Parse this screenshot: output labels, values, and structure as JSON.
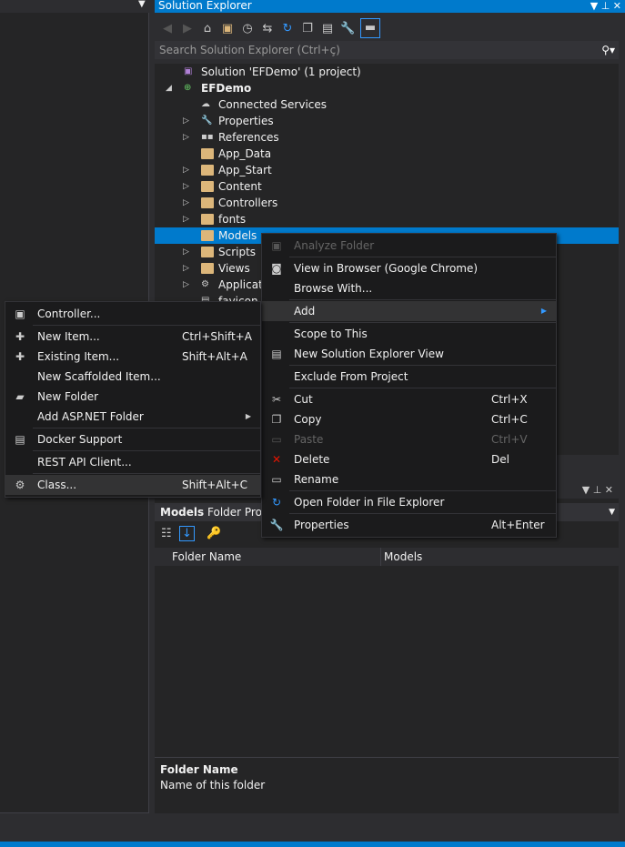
{
  "left_panel": {
    "dropdown_icon": "chevron-down-icon"
  },
  "solution_explorer": {
    "title": "Solution Explorer",
    "search_placeholder": "Search Solution Explorer (Ctrl+ç)",
    "tree": [
      {
        "label": "Solution 'EFDemo' (1 project)",
        "level": 0,
        "expander": "",
        "icon": "solution"
      },
      {
        "label": "EFDemo",
        "level": 0,
        "expander": "expanded",
        "icon": "web-project",
        "bold": true
      },
      {
        "label": "Connected Services",
        "level": 1,
        "expander": "",
        "icon": "cloud"
      },
      {
        "label": "Properties",
        "level": 1,
        "expander": "collapsed",
        "icon": "wrench"
      },
      {
        "label": "References",
        "level": 1,
        "expander": "collapsed",
        "icon": "references"
      },
      {
        "label": "App_Data",
        "level": 1,
        "expander": "",
        "icon": "folder"
      },
      {
        "label": "App_Start",
        "level": 1,
        "expander": "collapsed",
        "icon": "folder"
      },
      {
        "label": "Content",
        "level": 1,
        "expander": "collapsed",
        "icon": "folder"
      },
      {
        "label": "Controllers",
        "level": 1,
        "expander": "collapsed",
        "icon": "folder"
      },
      {
        "label": "fonts",
        "level": 1,
        "expander": "collapsed",
        "icon": "folder"
      },
      {
        "label": "Models",
        "level": 1,
        "expander": "",
        "icon": "folder",
        "selected": true
      },
      {
        "label": "Scripts",
        "level": 1,
        "expander": "collapsed",
        "icon": "folder"
      },
      {
        "label": "Views",
        "level": 1,
        "expander": "collapsed",
        "icon": "folder"
      },
      {
        "label": "Applicati",
        "level": 1,
        "expander": "collapsed",
        "icon": "config"
      },
      {
        "label": "favicon.i",
        "level": 1,
        "expander": "",
        "icon": "file"
      }
    ]
  },
  "properties": {
    "object_name": "Models",
    "object_type": "Folder Prope",
    "grid": [
      {
        "name": "Folder Name",
        "value": "Models"
      }
    ],
    "description_title": "Folder Name",
    "description_text": "Name of this folder"
  },
  "context_menu": [
    {
      "label": "Analyze Folder",
      "disabled": true,
      "icon": "analyze-icon"
    },
    {
      "sep": true
    },
    {
      "label": "View in Browser (Google Chrome)",
      "icon": "browser-icon"
    },
    {
      "label": "Browse With..."
    },
    {
      "sep": true
    },
    {
      "label": "Add",
      "submenu": true,
      "highlighted": true
    },
    {
      "sep": true
    },
    {
      "label": "Scope to This"
    },
    {
      "label": "New Solution Explorer View",
      "icon": "new-view-icon"
    },
    {
      "sep": true
    },
    {
      "label": "Exclude From Project"
    },
    {
      "sep": true
    },
    {
      "label": "Cut",
      "shortcut": "Ctrl+X",
      "icon": "scissors-icon"
    },
    {
      "label": "Copy",
      "shortcut": "Ctrl+C",
      "icon": "copy-icon"
    },
    {
      "label": "Paste",
      "shortcut": "Ctrl+V",
      "disabled": true,
      "icon": "paste-icon"
    },
    {
      "label": "Delete",
      "shortcut": "Del",
      "icon": "delete-icon"
    },
    {
      "label": "Rename",
      "icon": "rename-icon"
    },
    {
      "sep": true
    },
    {
      "label": "Open Folder in File Explorer",
      "icon": "open-folder-icon"
    },
    {
      "sep": true
    },
    {
      "label": "Properties",
      "shortcut": "Alt+Enter",
      "icon": "wrench-icon"
    }
  ],
  "add_submenu": [
    {
      "label": "Controller...",
      "icon": "controller-icon"
    },
    {
      "sep": true
    },
    {
      "label": "New Item...",
      "shortcut": "Ctrl+Shift+A",
      "icon": "new-item-icon"
    },
    {
      "label": "Existing Item...",
      "shortcut": "Shift+Alt+A",
      "icon": "existing-item-icon"
    },
    {
      "label": "New Scaffolded Item..."
    },
    {
      "label": "New Folder",
      "icon": "new-folder-icon"
    },
    {
      "label": "Add ASP.NET Folder",
      "submenu": true
    },
    {
      "sep": true
    },
    {
      "label": "Docker Support",
      "icon": "docker-icon"
    },
    {
      "sep": true
    },
    {
      "label": "REST API Client..."
    },
    {
      "sep": true
    },
    {
      "label": "Class...",
      "shortcut": "Shift+Alt+C",
      "highlighted": true,
      "icon": "class-icon"
    }
  ],
  "colors": {
    "accent": "#007acc",
    "background": "#252526",
    "menu": "#1b1b1c"
  }
}
